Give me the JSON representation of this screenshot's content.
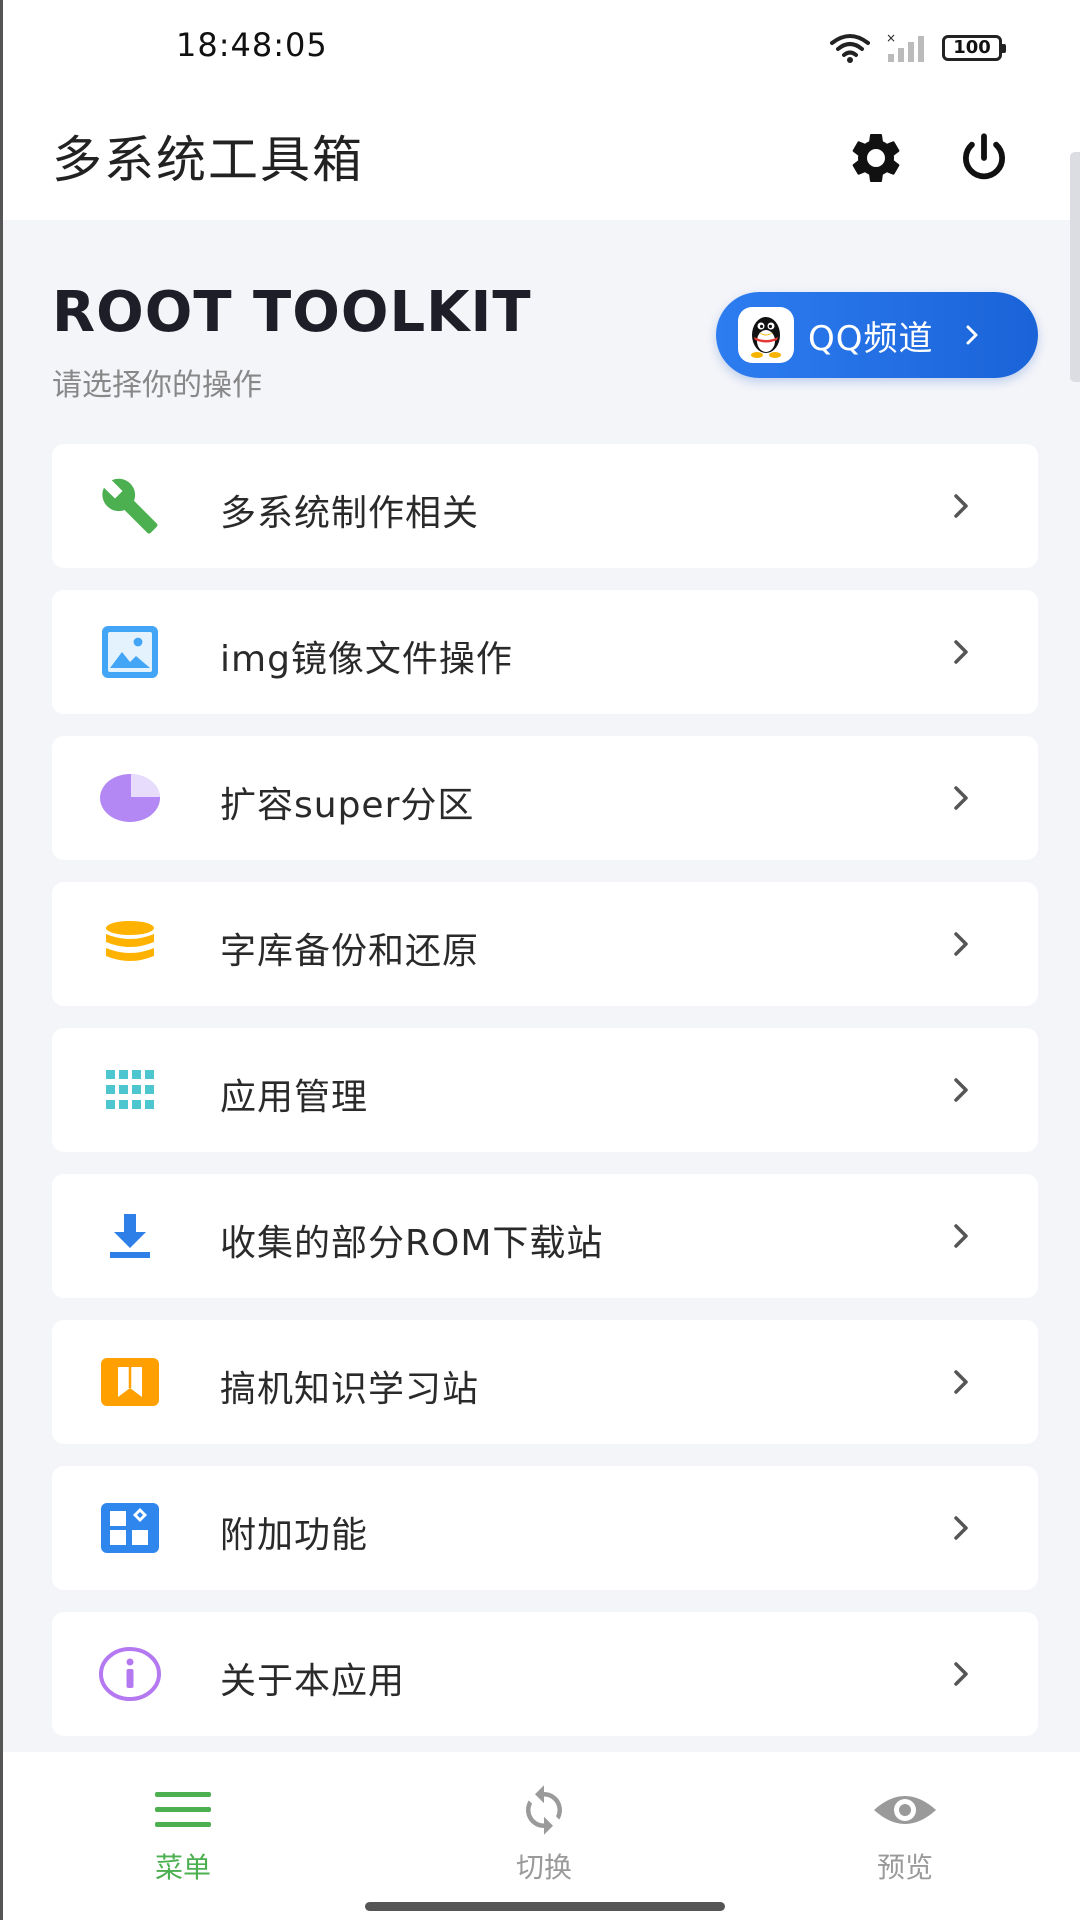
{
  "status_bar": {
    "time": "18:48:05",
    "battery": "100",
    "icons": [
      "wifi-icon",
      "signal-icon",
      "battery-icon"
    ]
  },
  "app_bar": {
    "title": "多系统工具箱",
    "icons": [
      "gear-icon",
      "power-icon"
    ]
  },
  "hero": {
    "title": "ROOT TOOLKIT",
    "subtitle": "请选择你的操作",
    "qq_button": "QQ频道",
    "qq_color": "#1a63d8"
  },
  "menu": {
    "items": [
      {
        "label": "多系统制作相关",
        "icon": "wrench-icon",
        "color": "#4caf50"
      },
      {
        "label": "img镜像文件操作",
        "icon": "image-icon",
        "color": "#42a5f5"
      },
      {
        "label": "扩容super分区",
        "icon": "pie-chart-icon",
        "color": "#b388f5"
      },
      {
        "label": "字库备份和还原",
        "icon": "database-icon",
        "color": "#ffb300"
      },
      {
        "label": "应用管理",
        "icon": "apps-grid-icon",
        "color": "#4dc6d0"
      },
      {
        "label": "收集的部分ROM下载站",
        "icon": "download-icon",
        "color": "#2f7fe8"
      },
      {
        "label": "搞机知识学习站",
        "icon": "book-icon",
        "color": "#ffa000"
      },
      {
        "label": "附加功能",
        "icon": "widgets-icon",
        "color": "#2f86ec"
      },
      {
        "label": "关于本应用",
        "icon": "info-icon",
        "color": "#b478f0"
      }
    ]
  },
  "bottom_nav": {
    "items": [
      {
        "label": "菜单",
        "icon": "menu-icon",
        "active": true
      },
      {
        "label": "切换",
        "icon": "sync-icon",
        "active": false
      },
      {
        "label": "预览",
        "icon": "eye-icon",
        "active": false
      }
    ],
    "active_color": "#4caf50",
    "inactive_color": "#9a9a9a"
  }
}
